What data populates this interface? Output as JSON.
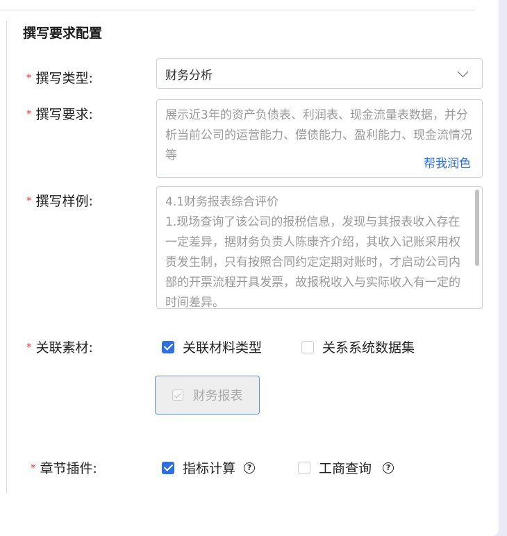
{
  "section": {
    "title": "撰写要求配置"
  },
  "fields": {
    "type": {
      "label": "撰写类型:",
      "value": "财务分析"
    },
    "requirement": {
      "label": "撰写要求:",
      "text": "展示近3年的资产负债表、利润表、现金流量表数据，并分析当前公司的运营能力、偿债能力、盈利能力、现金流情况等",
      "polish_label": "帮我润色"
    },
    "example": {
      "label": "撰写样例:",
      "lines": [
        "4.1财务报表综合评价",
        "1.现场查询了该公司的报税信息，发现与其报表收入存在一定差异，据财务负责人陈康齐介绍，其收入记账采用权责发生制，只有按照合同约定定期对账时，才启动公司内部的开票流程开具发票，故报税收入与实际收入有一定的时间差异。"
      ]
    },
    "materials": {
      "label": "关联素材:",
      "options": [
        {
          "label": "关联材料类型",
          "checked": true
        },
        {
          "label": "关系系统数据集",
          "checked": false
        }
      ],
      "tag": "财务报表"
    },
    "plugins": {
      "label": "章节插件:",
      "options": [
        {
          "label": "指标计算",
          "checked": true
        },
        {
          "label": "工商查询",
          "checked": false
        }
      ],
      "help_glyph": "?"
    }
  },
  "colors": {
    "accent": "#2f6fe0",
    "required": "#e64141",
    "background": "#e9eaf6"
  }
}
